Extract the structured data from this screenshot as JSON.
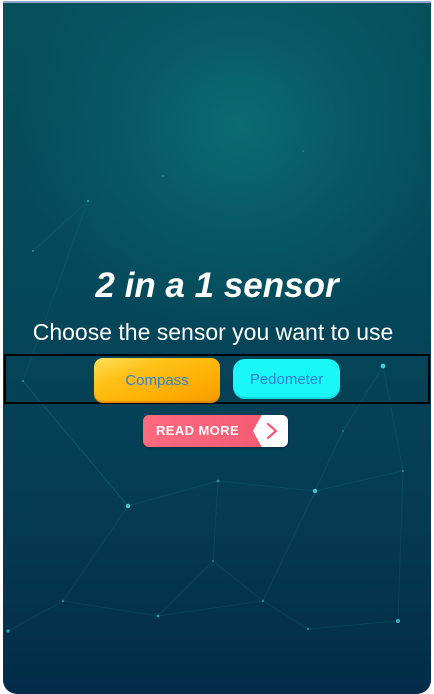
{
  "header": {
    "title": "2 in a 1 sensor",
    "subtitle": "Choose the sensor you want to use"
  },
  "sensors": {
    "compass_label": "Compass",
    "pedometer_label": "Pedometer"
  },
  "read_more": {
    "label": "READ MORE",
    "icon": "chevron-right-icon"
  },
  "colors": {
    "background_top": "#06505c",
    "background_bottom": "#032c49",
    "compass_button": "#ffb300",
    "pedometer_button": "#19f7f7",
    "button_text": "#2e7fcf",
    "read_more": "#f45a73"
  }
}
